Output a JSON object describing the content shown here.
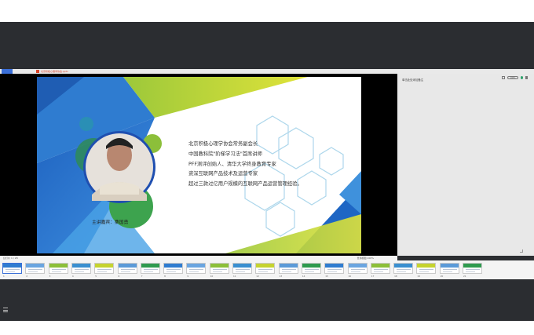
{
  "tab": {
    "file_name": "北京积极心理学协会.pptx"
  },
  "slide": {
    "bio_lines": [
      "北京积极心理学协会常务副会长",
      "中国教科院\"阶梯学习法\"首席讲师",
      "PFF测评创始人、清华大学终身教育专家",
      "资深互联网产品技术及运营专家",
      "超过三款过亿用户规模的互联网产品运营管理经验。"
    ],
    "speaker": "主讲嘉宾：桑国勇"
  },
  "panel": {
    "title": "单击此处添加备注",
    "zoom_label": "100%"
  },
  "status": {
    "slide_info": "幻灯片 1 / 28",
    "zoom": "普通视图  100%"
  },
  "thumbnails": [
    {
      "n": "1"
    },
    {
      "n": "2"
    },
    {
      "n": "3"
    },
    {
      "n": "4"
    },
    {
      "n": "5"
    },
    {
      "n": "6"
    },
    {
      "n": "7"
    },
    {
      "n": "8"
    },
    {
      "n": "9"
    },
    {
      "n": "10"
    },
    {
      "n": "11"
    },
    {
      "n": "12"
    },
    {
      "n": "13"
    },
    {
      "n": "14"
    },
    {
      "n": "15"
    },
    {
      "n": "16"
    },
    {
      "n": "17"
    },
    {
      "n": "18"
    },
    {
      "n": "19"
    },
    {
      "n": "20"
    },
    {
      "n": "21"
    }
  ],
  "colors": {
    "blue": "#2f6fc4",
    "lime": "#c5d32f",
    "green": "#2e9a4f",
    "accent": "#3a6fd8"
  }
}
